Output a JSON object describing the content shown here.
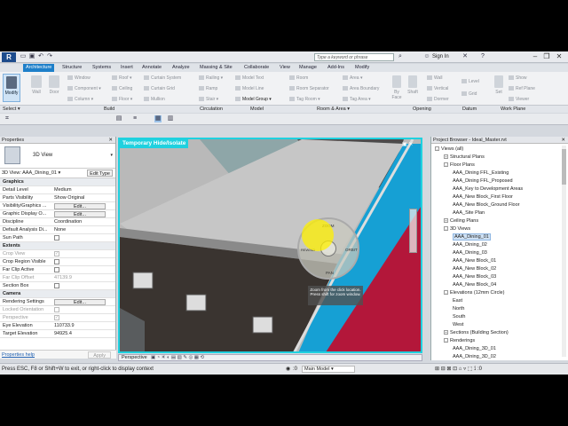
{
  "titlebar": {
    "search_placeholder": "Type a keyword or phrase",
    "sign_in": "Sign In"
  },
  "tabs": [
    "Architecture",
    "Structure",
    "Systems",
    "Insert",
    "Annotate",
    "Analyze",
    "Massing & Site",
    "Collaborate",
    "View",
    "Manage",
    "Add-Ins",
    "Modify"
  ],
  "ribbon": {
    "modify": "Modify",
    "build": {
      "wall": "Wall",
      "door": "Door",
      "window": "Window",
      "component": "Component",
      "column": "Column",
      "roof": "Roof",
      "ceiling": "Ceiling",
      "floor": "Floor",
      "curtain_system": "Curtain System",
      "curtain_grid": "Curtain Grid",
      "mullion": "Mullion"
    },
    "circulation": {
      "railing": "Railing",
      "ramp": "Ramp",
      "stair": "Stair"
    },
    "model": {
      "model_text": "Model Text",
      "model_line": "Model Line",
      "model_group": "Model  Group"
    },
    "room_area": {
      "room": "Room",
      "room_separator": "Room Separator",
      "tag_room": "Tag Room",
      "area": "Area",
      "area_boundary": "Area Boundary",
      "tag_area": "Tag Area"
    },
    "opening": {
      "by_face": "By Face",
      "shaft": "Shaft",
      "wall": "Wall",
      "vertical": "Vertical",
      "dormer": "Dormer"
    },
    "datum": {
      "level": "Level",
      "grid": "Grid"
    },
    "work_plane": {
      "set": "Set",
      "show": "Show",
      "ref_plane": "Ref Plane",
      "viewer": "Viewer"
    },
    "groups": [
      "Select",
      "Build",
      "Circulation",
      "Model",
      "Room & Area",
      "Opening",
      "Datum",
      "Work Plane"
    ]
  },
  "properties": {
    "title": "Properties",
    "type_name": "3D View",
    "view_selector": "3D View: AAA_Dining_01",
    "edit_type": "Edit Type",
    "rows": [
      {
        "k": "Graphics",
        "cat": true
      },
      {
        "k": "Detail Level",
        "v": "Medium"
      },
      {
        "k": "Parts Visibility",
        "v": "Show Original"
      },
      {
        "k": "Visibility/Graphics ...",
        "v": "Edit...",
        "btn": true
      },
      {
        "k": "Graphic Display O...",
        "v": "Edit...",
        "btn": true
      },
      {
        "k": "Discipline",
        "v": "Coordination"
      },
      {
        "k": "Default Analysis Di...",
        "v": "None"
      },
      {
        "k": "Sun Path",
        "chk": true
      },
      {
        "k": "Extents",
        "cat": true
      },
      {
        "k": "Crop View",
        "chk": true,
        "checked": true,
        "dim": true
      },
      {
        "k": "Crop Region Visible",
        "chk": true
      },
      {
        "k": "Far Clip Active",
        "chk": true
      },
      {
        "k": "Far Clip Offset",
        "v": "47139.9",
        "dim": true
      },
      {
        "k": "Section Box",
        "chk": true
      },
      {
        "k": "Camera",
        "cat": true
      },
      {
        "k": "Rendering Settings",
        "v": "Edit...",
        "btn": true
      },
      {
        "k": "Locked Orientation",
        "chk": true,
        "dim": true
      },
      {
        "k": "Perspective",
        "chk": true,
        "checked": true,
        "dim": true
      },
      {
        "k": "Eye Elevation",
        "v": "110733.9"
      },
      {
        "k": "Target Elevation",
        "v": "94925.4"
      }
    ],
    "help": "Properties help",
    "apply": "Apply"
  },
  "viewport": {
    "title": "Temporary Hide/Isolate",
    "wheel_labels": [
      "ZOOM",
      "REWIND",
      "PAN",
      "ORBIT"
    ],
    "tooltip": "Zoom from the click location. Press shift for zoom window.",
    "view_mode": "Perspective"
  },
  "browser": {
    "title": "Project Browser - Ideal_Master.rvt",
    "items": [
      {
        "label": "Views (all)",
        "indent": 0,
        "tw": "-"
      },
      {
        "label": "Structural Plans",
        "indent": 1,
        "tw": "+"
      },
      {
        "label": "Floor Plans",
        "indent": 1,
        "tw": "-"
      },
      {
        "label": "AAA_Dining FFL_Existing",
        "indent": 2
      },
      {
        "label": "AAA_Dining FFL_Proposed",
        "indent": 2
      },
      {
        "label": "AAA_Key to Development Areas",
        "indent": 2
      },
      {
        "label": "AAA_New Block_First Floor",
        "indent": 2
      },
      {
        "label": "AAA_New Block_Ground Floor",
        "indent": 2
      },
      {
        "label": "AAA_Site Plan",
        "indent": 2
      },
      {
        "label": "Ceiling Plans",
        "indent": 1,
        "tw": "+"
      },
      {
        "label": "3D Views",
        "indent": 1,
        "tw": "-"
      },
      {
        "label": "AAA_Dining_01",
        "indent": 2,
        "sel": true
      },
      {
        "label": "AAA_Dining_02",
        "indent": 2
      },
      {
        "label": "AAA_Dining_03",
        "indent": 2
      },
      {
        "label": "AAA_New Block_01",
        "indent": 2
      },
      {
        "label": "AAA_New Block_02",
        "indent": 2
      },
      {
        "label": "AAA_New Block_03",
        "indent": 2
      },
      {
        "label": "AAA_New Block_04",
        "indent": 2
      },
      {
        "label": "Elevations (12mm Circle)",
        "indent": 1,
        "tw": "-"
      },
      {
        "label": "East",
        "indent": 2
      },
      {
        "label": "North",
        "indent": 2
      },
      {
        "label": "South",
        "indent": 2
      },
      {
        "label": "West",
        "indent": 2
      },
      {
        "label": "Sections (Building Section)",
        "indent": 1,
        "tw": "+"
      },
      {
        "label": "Renderings",
        "indent": 1,
        "tw": "-"
      },
      {
        "label": "AAA_Dining_3D_01",
        "indent": 2
      },
      {
        "label": "AAA_Dining_3D_02",
        "indent": 2
      }
    ]
  },
  "status": {
    "text": "Press ESC, F8 or Shift+W to exit, or right-click to display context",
    "main_model": "Main Model",
    "zero": ":0"
  },
  "colors": {
    "accent": "#1d7fc9",
    "isolate": "#1fd1df",
    "floor_red": "#b3173a",
    "glass": "#1a8fc0"
  }
}
